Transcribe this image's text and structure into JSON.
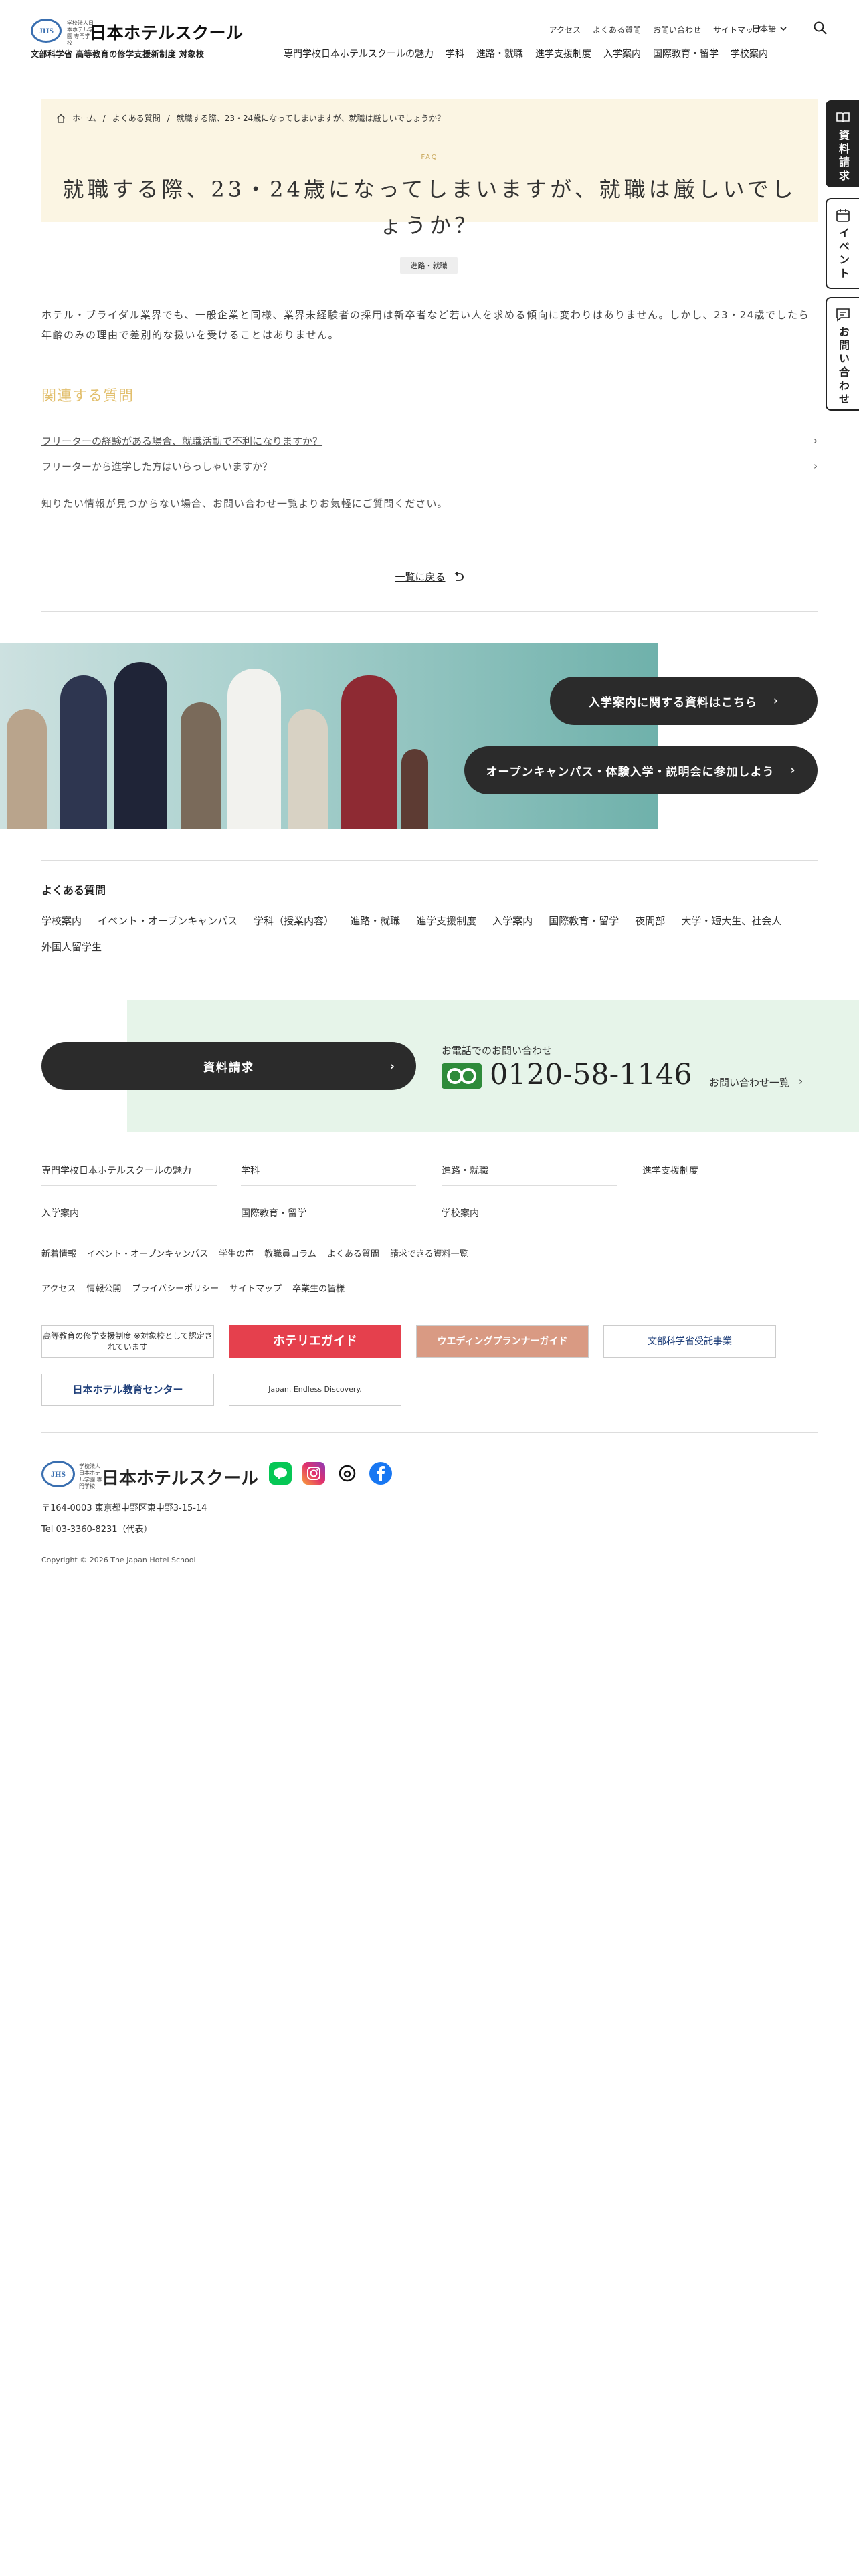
{
  "header": {
    "logo_small": "学校法人日本ホテル学園 専門学校",
    "logo_name": "日本ホテルスクール",
    "logo_sub": "文部科学省 高等教育の修学支援新制度 対象校",
    "util_nav": [
      "アクセス",
      "よくある質問",
      "お問い合わせ",
      "サイトマップ"
    ],
    "language": "日本語",
    "main_nav": [
      "専門学校日本ホテルスクールの魅力",
      "学科",
      "進路・就職",
      "進学支援制度",
      "入学案内",
      "国際教育・留学",
      "学校案内"
    ]
  },
  "side_tabs": {
    "request": "資料請求",
    "event": "イベント",
    "contact": "お問い合わせ"
  },
  "breadcrumb": {
    "home": "ホーム",
    "faq": "よくある質問",
    "current": "就職する際、23・24歳になってしまいますが、就職は厳しいでしょうか？"
  },
  "hero": {
    "eyebrow": "FAQ",
    "title": "就職する際、23・24歳になってしまいますが、就職は厳しいでしょうか？",
    "category": "進路・就職"
  },
  "answer": "ホテル・ブライダル業界でも、一般企業と同様、業界未経験者の採用は新卒者など若い人を求める傾向に変わりはありません。しかし、23・24歳でしたら年齢のみの理由で差別的な扱いを受けることはありません。",
  "related": {
    "heading": "関連する質問",
    "items": [
      "フリーターの経験がある場合、就職活動で不利になりますか？",
      "フリーターから進学した方はいらっしゃいますか？"
    ]
  },
  "help": {
    "before": "知りたい情報が見つからない場合、",
    "link": "お問い合わせ一覧",
    "after": "よりお気軽にご質問ください。"
  },
  "back_label": "一覧に戻る",
  "banner": {
    "cta1": "入学案内に関する資料はこちら",
    "cta2": "オープンキャンパス・体験入学・説明会に参加しよう"
  },
  "faq_categories": {
    "title": "よくある質問",
    "items": [
      "学校案内",
      "イベント・オープンキャンパス",
      "学科（授業内容）",
      "進路・就職",
      "進学支援制度",
      "入学案内",
      "国際教育・留学",
      "夜間部",
      "大学・短大生、社会人",
      "外国人留学生"
    ]
  },
  "contact": {
    "request_label": "資料請求",
    "phone_label": "お電話でのお問い合わせ",
    "phone_number": "0120-58-1146",
    "list_label": "お問い合わせ一覧"
  },
  "footer_nav": [
    "専門学校日本ホテルスクールの魅力",
    "学科",
    "進路・就職",
    "進学支援制度",
    "入学案内",
    "国際教育・留学",
    "学校案内"
  ],
  "footer_links_1": [
    "新着情報",
    "イベント・オープンキャンパス",
    "学生の声",
    "教職員コラム",
    "よくある質問",
    "請求できる資料一覧"
  ],
  "footer_links_2": [
    "アクセス",
    "情報公開",
    "プライバシーポリシー",
    "サイトマップ",
    "卒業生の皆様"
  ],
  "footer_banners": [
    "高等教育の修学支援制度 ※対象校として認定されています",
    "ホテリエガイド",
    "ウエディングプランナーガイド",
    "文部科学省受託事業",
    "日本ホテル教育センター",
    "Japan. Endless Discovery."
  ],
  "footer": {
    "address": "〒164-0003 東京都中野区東中野3-15-14",
    "tel": "Tel 03-3360-8231（代表）",
    "copyright": "Copyright © 2026 The Japan Hotel School"
  },
  "colors": {
    "accent_gold": "#e2bf6d",
    "hero_bg": "#fbf5e3",
    "contact_bg": "#e6f4e9",
    "dark_button": "#2b2b2b",
    "freedial_green": "#2e8b3a"
  }
}
